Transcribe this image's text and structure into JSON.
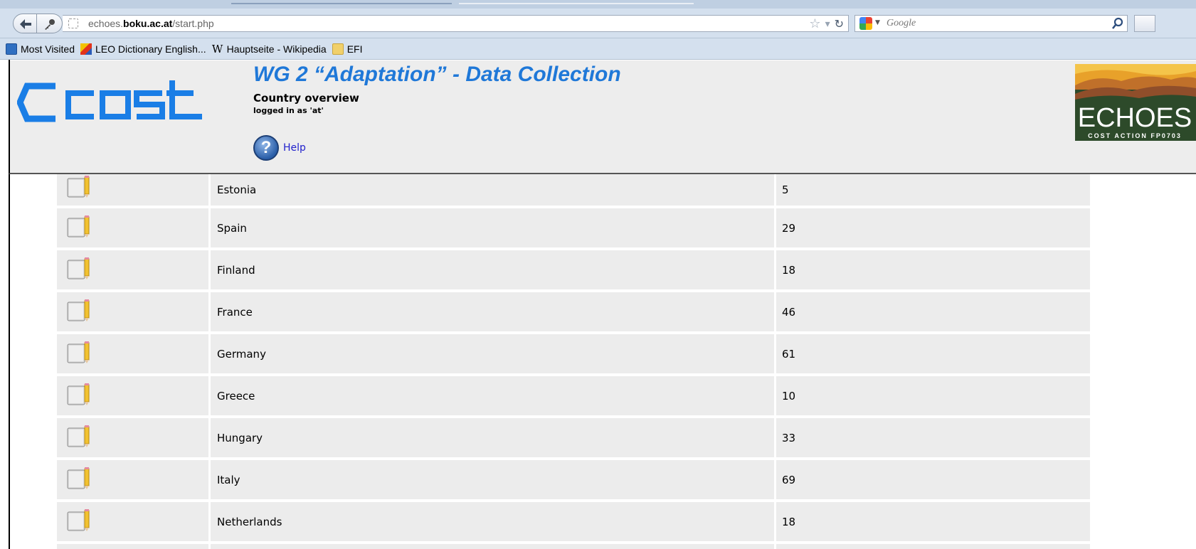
{
  "browser": {
    "url_prefix": "echoes.",
    "url_domain": "boku.ac.at",
    "url_path": "/start.php",
    "search_placeholder": "Google",
    "bookmarks": [
      {
        "label": "Most Visited"
      },
      {
        "label": "LEO Dictionary English..."
      },
      {
        "label": "Hauptseite - Wikipedia",
        "icon_text": "W"
      },
      {
        "label": "EFI"
      }
    ]
  },
  "header": {
    "title": "WG 2 “Adaptation” - Data Collection",
    "section": "Country overview",
    "login": "logged in as 'at'",
    "help_label": "Help",
    "help_icon_text": "?",
    "logo_left_text": "cost",
    "logo_right_text": "ECHOES",
    "logo_right_subtext": "COST ACTION FP0703",
    "colors": {
      "title": "#1f78d8",
      "cost_logo": "#1a7ee6",
      "echoes_green": "#2d4a2a"
    }
  },
  "countries": [
    {
      "name": "Estonia",
      "count": "5"
    },
    {
      "name": "Spain",
      "count": "29"
    },
    {
      "name": "Finland",
      "count": "18"
    },
    {
      "name": "France",
      "count": "46"
    },
    {
      "name": "Germany",
      "count": "61"
    },
    {
      "name": "Greece",
      "count": "10"
    },
    {
      "name": "Hungary",
      "count": "33"
    },
    {
      "name": "Italy",
      "count": "69"
    },
    {
      "name": "Netherlands",
      "count": "18"
    }
  ]
}
